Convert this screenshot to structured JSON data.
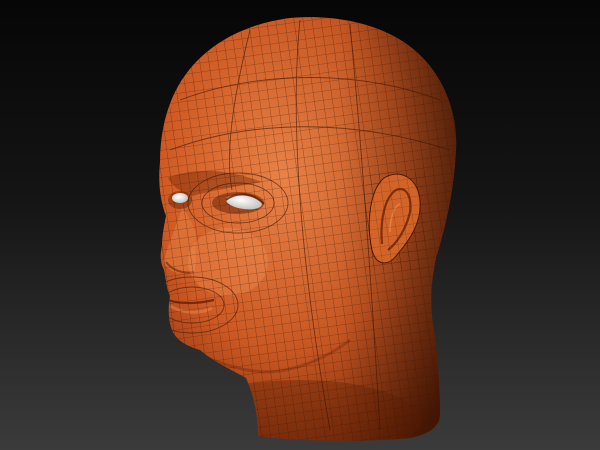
{
  "scene": {
    "subject": "head-model",
    "render_style": "wireframe-over-shaded",
    "colors": {
      "background_top": "#060606",
      "background_bottom": "#3b3b3b",
      "skin_light": "#f0874a",
      "skin_mid": "#cf5a23",
      "skin_dark": "#6a2206",
      "wire": "#3a1304",
      "eye_white": "#e9e6e2"
    }
  }
}
